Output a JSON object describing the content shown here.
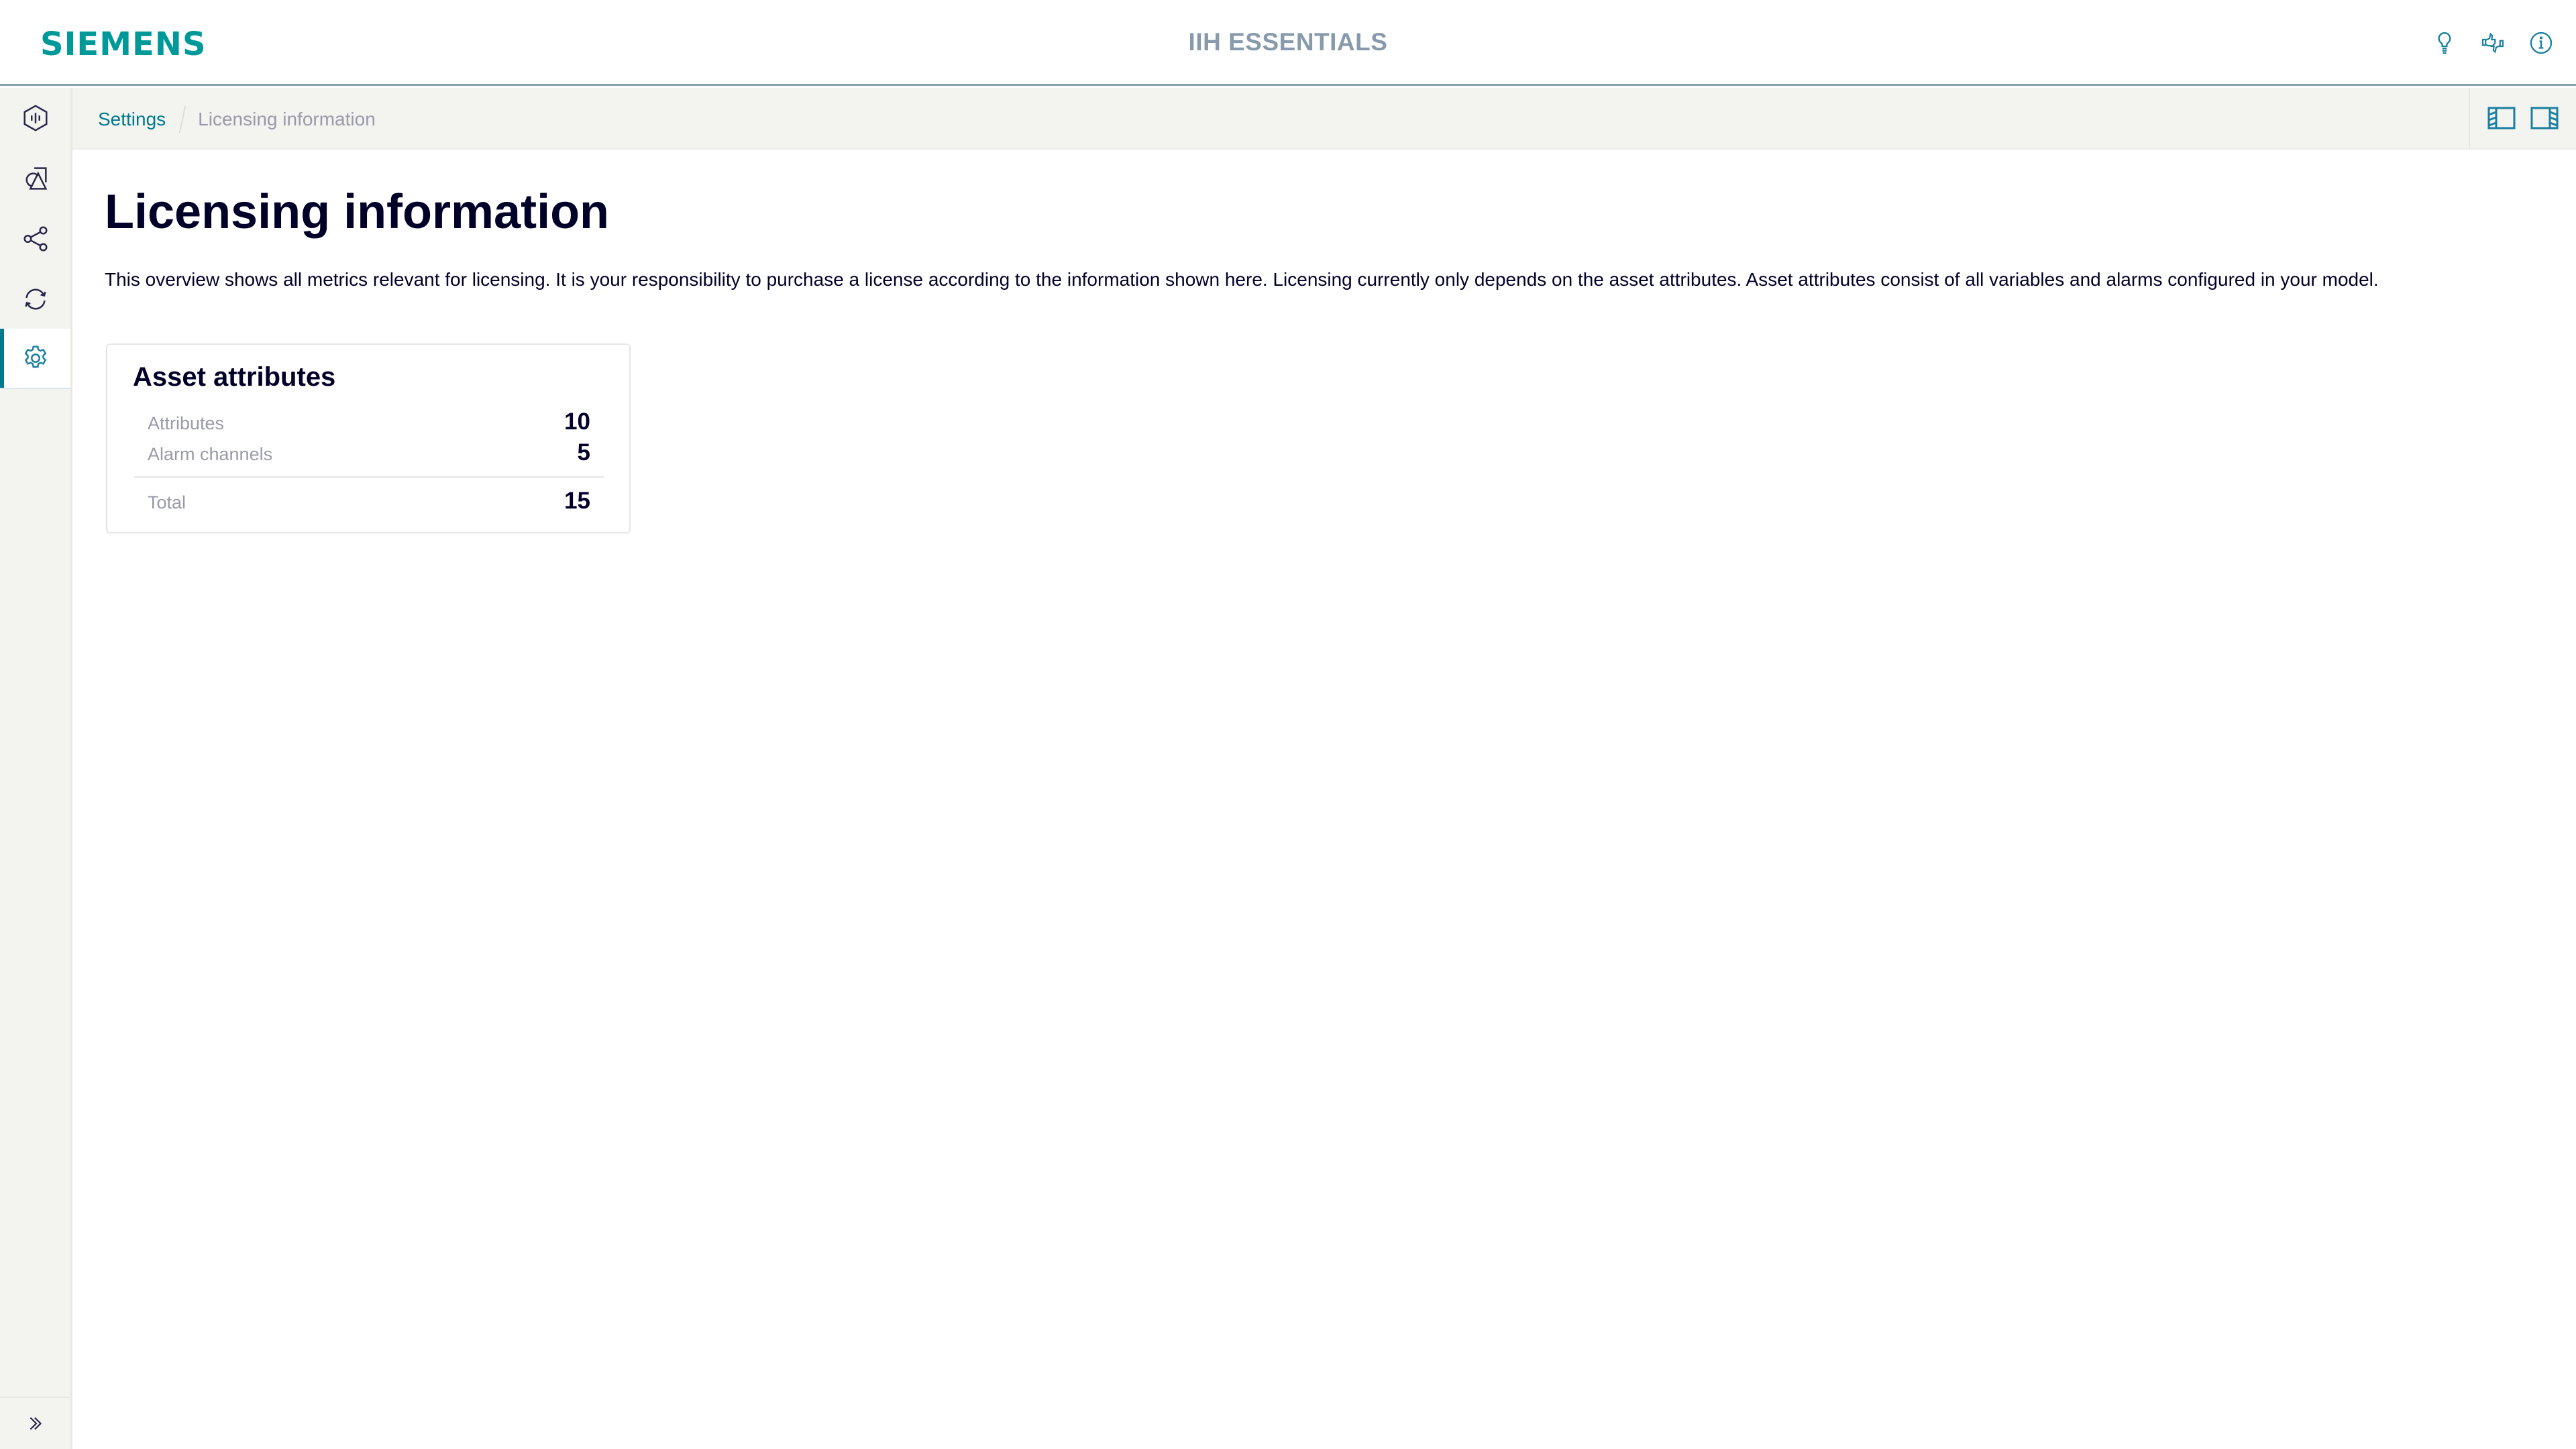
{
  "header": {
    "logo": "SIEMENS",
    "app_title": "IIH ESSENTIALS",
    "icons": [
      {
        "name": "lightbulb-icon",
        "label": "Tips"
      },
      {
        "name": "feedback-thumbs-icon",
        "label": "Feedback"
      },
      {
        "name": "info-icon",
        "label": "Info"
      }
    ]
  },
  "sidebar": {
    "items": [
      {
        "name": "asset-model-icon",
        "active": false
      },
      {
        "name": "shapes-icon",
        "active": false
      },
      {
        "name": "share-connections-icon",
        "active": false
      },
      {
        "name": "sync-icon",
        "active": false
      },
      {
        "name": "settings-gear-icon",
        "active": true
      }
    ],
    "expand_icon": "double-chevron-right-icon"
  },
  "breadcrumb": {
    "parent": "Settings",
    "current": "Licensing information"
  },
  "main": {
    "title": "Licensing information",
    "description": "This overview shows all metrics relevant for licensing. It is your responsibility to purchase a license according to the information shown here. Licensing currently only depends on the asset attributes. Asset attributes consist of all variables and alarms configured in your model.",
    "card": {
      "title": "Asset attributes",
      "rows": [
        {
          "label": "Attributes",
          "value": "10"
        },
        {
          "label": "Alarm channels",
          "value": "5"
        }
      ],
      "total": {
        "label": "Total",
        "value": "15"
      }
    }
  },
  "colors": {
    "brand": "#009999",
    "accent": "#007a8e",
    "text": "#000028",
    "muted": "#9a9aa9"
  }
}
